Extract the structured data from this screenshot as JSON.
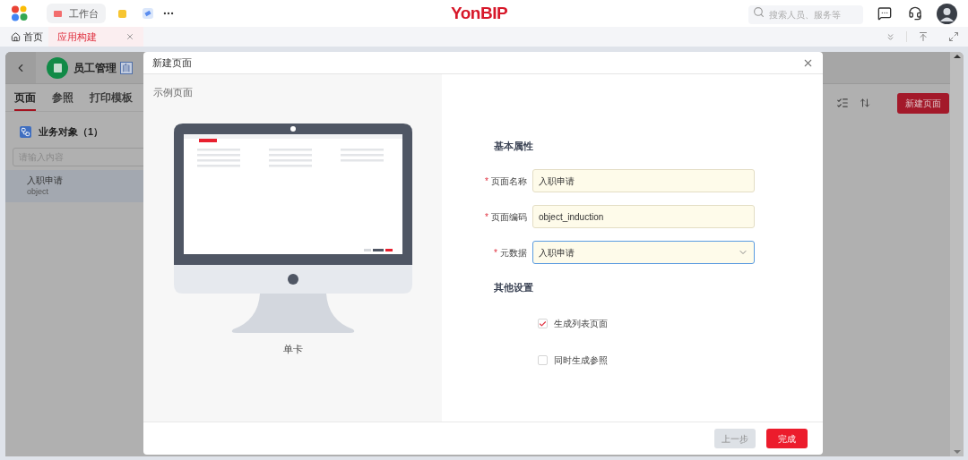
{
  "top_bar": {
    "workbench_tab": "工作台",
    "logo": "YonBIP",
    "search": {
      "placeholder": "搜索人员、服务等"
    }
  },
  "tabs": [
    {
      "label": "首页",
      "selected": false,
      "kind": "home"
    },
    {
      "label": "应用构建",
      "selected": true,
      "kind": "page"
    }
  ],
  "app": {
    "title": "员工管理",
    "badge": "自",
    "tabs": [
      {
        "label": "页面",
        "selected": true
      },
      {
        "label": "参照",
        "selected": false
      },
      {
        "label": "打印模板",
        "selected": false
      }
    ],
    "object_group": "业务对象（1）",
    "search": {
      "placeholder": "请输入内容"
    },
    "objects": [
      {
        "name": "入职申请",
        "code": "object",
        "selected": true
      }
    ],
    "new_page_button": "新建页面"
  },
  "dialog": {
    "title": "新建页面",
    "preview_label": "示例页面",
    "preview_caption": "单卡",
    "sections": [
      {
        "title": "基本属性",
        "kind": "fields",
        "fields": [
          {
            "label": "页面名称",
            "required_mark": "*",
            "value": "入职申请",
            "kind": "text",
            "focused": false
          },
          {
            "label": "页面编码",
            "required_mark": "*",
            "value": "object_induction",
            "kind": "text",
            "focused": false
          },
          {
            "label": "元数据",
            "required_mark": "*",
            "value": "入职申请",
            "kind": "select",
            "focused": true
          }
        ]
      },
      {
        "title": "其他设置",
        "kind": "options",
        "options": [
          {
            "label": "生成列表页面",
            "checked": true
          },
          {
            "label": "同时生成参照",
            "checked": false
          }
        ]
      }
    ],
    "buttons": [
      {
        "label": "上一步",
        "kind": "secondary"
      },
      {
        "label": "完成",
        "kind": "primary"
      }
    ]
  }
}
